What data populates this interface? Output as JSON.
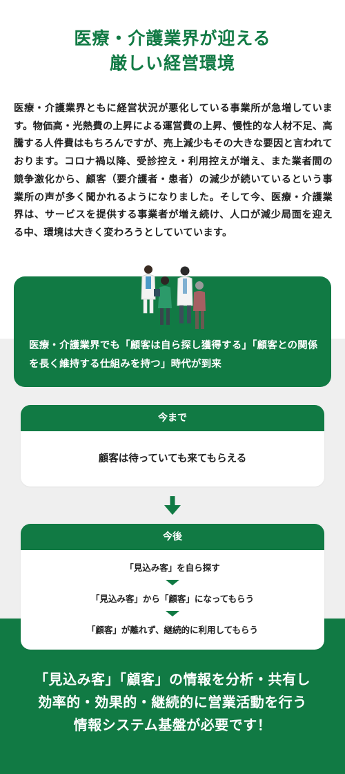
{
  "header": {
    "title_line1": "医療・介護業界が迎える",
    "title_line2": "厳しい経営環境"
  },
  "intro": {
    "text": "医療・介護業界ともに経営状況が悪化している事業所が急増しています。物価高・光熱費の上昇による運営費の上昇、慢性的な人材不足、高騰する人件費はもちろんですが、売上減少もその大きな要因と言われております。コロナ禍以降、受診控え・利用控えが増え、また業者間の競争激化から、顧客（要介護者・患者）の減少が続いているという事業所の声が多く聞かれるようになりました。そして今、医療・介護業界は、サービスを提供する事業者が増え続け、人口が減少局面を迎える中、環境は大きく変わろうとしていています。"
  },
  "highlight": {
    "text": "医療・介護業界でも「顧客は自ら探し獲得する」「顧客との関係を長く維持する仕組みを持つ」時代が到来"
  },
  "before": {
    "label": "今まで",
    "text": "顧客は待っていても来てもらえる"
  },
  "after": {
    "label": "今後",
    "steps": [
      "「見込み客」を自ら探す",
      "「見込み客」から「顧客」になってもらう",
      "「顧客」が離れず、継続的に利用してもらう"
    ]
  },
  "conclusion": {
    "line1": "「見込み客」「顧客」の情報を分析・共有し",
    "line2": "効率的・効果的・継続的に営業活動を行う",
    "line3": "情報システム基盤が必要です！"
  },
  "colors": {
    "brand_green": "#117a44",
    "band_gray": "#efefef"
  },
  "icons": [
    "medical-staff-illustration",
    "down-arrow-icon",
    "triangle-down-icon"
  ]
}
